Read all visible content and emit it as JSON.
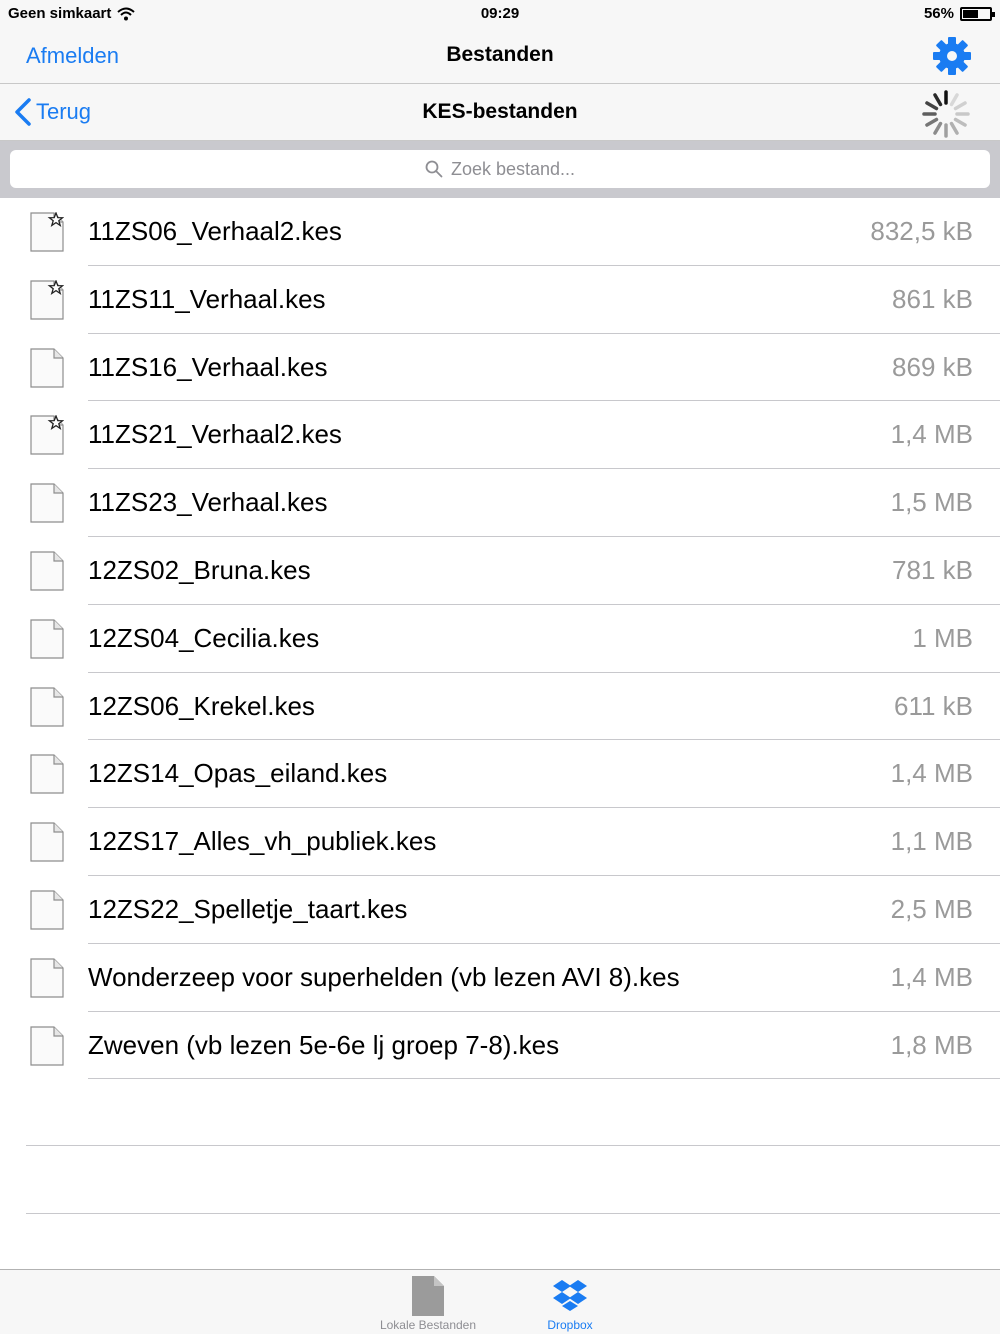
{
  "status_bar": {
    "carrier": "Geen simkaart",
    "time": "09:29",
    "battery": "56%",
    "battery_level": 0.56
  },
  "top_nav": {
    "left_button": "Afmelden",
    "title": "Bestanden",
    "right_icon": "gear-icon"
  },
  "sub_nav": {
    "back_label": "Terug",
    "title": "KES-bestanden",
    "right_icon": "activity-spinner-icon"
  },
  "search": {
    "placeholder": "Zoek bestand..."
  },
  "files": [
    {
      "name": "11ZS06_Verhaal2.kes",
      "size": "832,5 kB",
      "starred": true
    },
    {
      "name": "11ZS11_Verhaal.kes",
      "size": "861 kB",
      "starred": true
    },
    {
      "name": "11ZS16_Verhaal.kes",
      "size": "869 kB",
      "starred": false
    },
    {
      "name": "11ZS21_Verhaal2.kes",
      "size": "1,4 MB",
      "starred": true
    },
    {
      "name": "11ZS23_Verhaal.kes",
      "size": "1,5 MB",
      "starred": false
    },
    {
      "name": "12ZS02_Bruna.kes",
      "size": "781 kB",
      "starred": false
    },
    {
      "name": "12ZS04_Cecilia.kes",
      "size": "1 MB",
      "starred": false
    },
    {
      "name": "12ZS06_Krekel.kes",
      "size": "611 kB",
      "starred": false
    },
    {
      "name": "12ZS14_Opas_eiland.kes",
      "size": "1,4 MB",
      "starred": false
    },
    {
      "name": "12ZS17_Alles_vh_publiek.kes",
      "size": "1,1 MB",
      "starred": false
    },
    {
      "name": "12ZS22_Spelletje_taart.kes",
      "size": "2,5 MB",
      "starred": false
    },
    {
      "name": "Wonderzeep voor superhelden (vb lezen AVI 8).kes",
      "size": "1,4 MB",
      "starred": false
    },
    {
      "name": "Zweven (vb lezen 5e-6e lj groep 7-8).kes",
      "size": "1,8 MB",
      "starred": false
    }
  ],
  "tab_bar": {
    "tabs": [
      {
        "label": "Lokale Bestanden",
        "icon": "document-icon",
        "selected": false
      },
      {
        "label": "Dropbox",
        "icon": "dropbox-icon",
        "selected": true
      }
    ]
  },
  "colors": {
    "accent": "#1a7cf2",
    "secondary_text": "#9a9a9a",
    "separator": "#c8c8cc",
    "bar_background": "#f7f7f7",
    "search_background": "#c9c9ce"
  }
}
